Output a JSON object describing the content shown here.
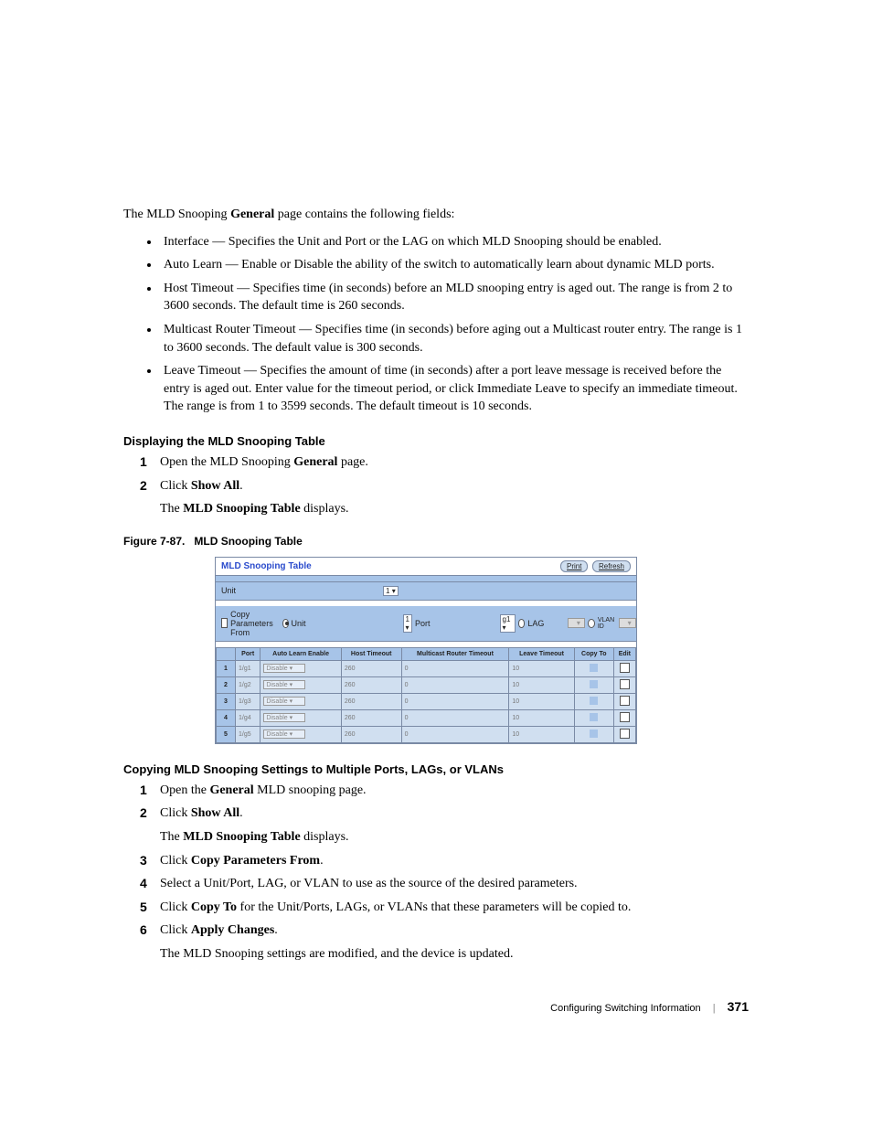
{
  "intro": {
    "prefix": "The MLD Snooping ",
    "bold": "General",
    "suffix": " page contains the following fields:"
  },
  "bullets": [
    "Interface — Specifies the Unit and Port or the LAG on which MLD Snooping should be enabled.",
    "Auto Learn — Enable or Disable the ability of the switch to automatically learn about dynamic MLD ports.",
    "Host Timeout — Specifies time (in seconds) before an MLD snooping entry is aged out. The range is from 2 to 3600 seconds. The default time is 260 seconds.",
    "Multicast Router Timeout — Specifies time (in seconds) before aging out a Multicast router entry. The range is 1 to 3600 seconds. The default value is 300 seconds.",
    "Leave Timeout — Specifies the amount of time (in seconds) after a port leave message is received before the entry is aged out. Enter value for the timeout period, or click Immediate Leave to specify an immediate timeout. The range is from 1 to 3599 seconds. The default timeout is 10 seconds."
  ],
  "section1_heading": "Displaying the MLD Snooping Table",
  "section1_steps": [
    {
      "prefix": "Open the MLD Snooping ",
      "bold": "General",
      "suffix": " page."
    },
    {
      "prefix": "Click ",
      "bold": "Show All",
      "suffix": ".",
      "sub_prefix": "The ",
      "sub_bold": "MLD Snooping Table",
      "sub_suffix": " displays."
    }
  ],
  "figure_caption_num": "Figure 7-87.",
  "figure_caption_title": "MLD Snooping Table",
  "panel": {
    "title": "MLD Snooping Table",
    "btn_print": "Print",
    "btn_refresh": "Refresh",
    "band_unit_label": "Unit",
    "band_unit_value": "1",
    "copy_label": "Copy Parameters From",
    "copy_unit_label": "Unit",
    "copy_unit_value": "1",
    "copy_port_label": "Port",
    "copy_port_value": "g1",
    "copy_lag_label": "LAG",
    "copy_vlan_label": "VLAN ID",
    "headers": [
      "",
      "Port",
      "Auto Learn Enable",
      "Host Timeout",
      "Multicast Router Timeout",
      "Leave Timeout",
      "Copy To",
      "Edit"
    ],
    "rows": [
      {
        "idx": "1",
        "port": "1/g1",
        "auto": "Disable",
        "host": "260",
        "mrt": "0",
        "leave": "10"
      },
      {
        "idx": "2",
        "port": "1/g2",
        "auto": "Disable",
        "host": "260",
        "mrt": "0",
        "leave": "10"
      },
      {
        "idx": "3",
        "port": "1/g3",
        "auto": "Disable",
        "host": "260",
        "mrt": "0",
        "leave": "10"
      },
      {
        "idx": "4",
        "port": "1/g4",
        "auto": "Disable",
        "host": "260",
        "mrt": "0",
        "leave": "10"
      },
      {
        "idx": "5",
        "port": "1/g5",
        "auto": "Disable",
        "host": "260",
        "mrt": "0",
        "leave": "10"
      }
    ]
  },
  "section2_heading": "Copying MLD Snooping Settings to Multiple Ports, LAGs, or VLANs",
  "section2_steps": [
    {
      "prefix": "Open the ",
      "bold": "General",
      "suffix": " MLD snooping page."
    },
    {
      "prefix": "Click ",
      "bold": "Show All",
      "suffix": ".",
      "sub_prefix": "The ",
      "sub_bold": "MLD Snooping Table",
      "sub_suffix": " displays."
    },
    {
      "prefix": "Click ",
      "bold": "Copy Parameters From",
      "suffix": "."
    },
    {
      "prefix": "Select a Unit/Port, LAG, or VLAN to use as the source of the desired parameters.",
      "bold": "",
      "suffix": ""
    },
    {
      "prefix": "Click ",
      "bold": "Copy To",
      "suffix": " for the Unit/Ports, LAGs, or VLANs that these parameters will be copied to."
    },
    {
      "prefix": "Click ",
      "bold": "Apply Changes",
      "suffix": ".",
      "sub_prefix": "The MLD Snooping settings are modified, and the device is updated.",
      "sub_bold": "",
      "sub_suffix": ""
    }
  ],
  "footer_text": "Configuring Switching Information",
  "page_number": "371"
}
